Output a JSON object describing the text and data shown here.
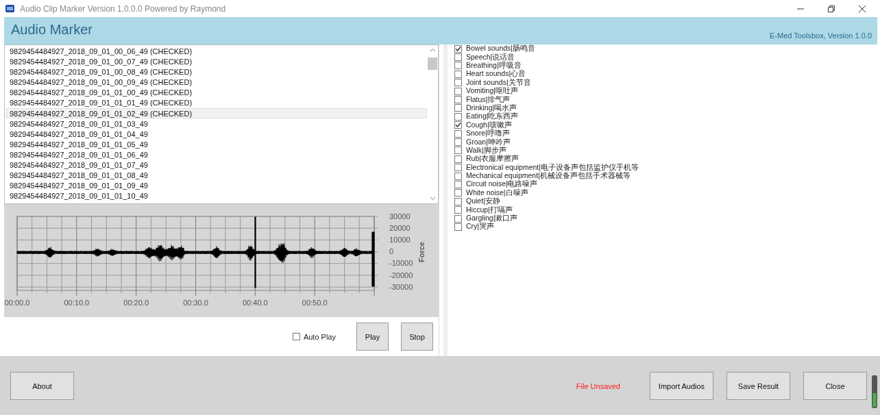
{
  "window": {
    "title": "Audio Clip Marker Version 1.0.0.0 Powered by Raymond"
  },
  "header": {
    "title": "Audio Marker",
    "version": "E-Med Toolsbox, Version 1.0.0"
  },
  "files": [
    {
      "name": "9829454484927_2018_09_01_00_06_49 (CHECKED)",
      "selected": false
    },
    {
      "name": "9829454484927_2018_09_01_00_07_49 (CHECKED)",
      "selected": false
    },
    {
      "name": "9829454484927_2018_09_01_00_08_49 (CHECKED)",
      "selected": false
    },
    {
      "name": "9829454484927_2018_09_01_00_09_49 (CHECKED)",
      "selected": false
    },
    {
      "name": "9829454484927_2018_09_01_01_00_49 (CHECKED)",
      "selected": false
    },
    {
      "name": "9829454484927_2018_09_01_01_01_49 (CHECKED)",
      "selected": false
    },
    {
      "name": "9829454484927_2018_09_01_01_02_49 (CHECKED)",
      "selected": true
    },
    {
      "name": "9829454484927_2018_09_01_01_03_49",
      "selected": false
    },
    {
      "name": "9829454484927_2018_09_01_01_04_49",
      "selected": false
    },
    {
      "name": "9829454484927_2018_09_01_01_05_49",
      "selected": false
    },
    {
      "name": "9829454484927_2018_09_01_01_06_49",
      "selected": false
    },
    {
      "name": "9829454484927_2018_09_01_01_07_49",
      "selected": false
    },
    {
      "name": "9829454484927_2018_09_01_01_08_49",
      "selected": false
    },
    {
      "name": "9829454484927_2018_09_01_01_09_49",
      "selected": false
    },
    {
      "name": "9829454484927_2018_09_01_01_10_49",
      "selected": false
    }
  ],
  "waveform": {
    "ylabel": "Force",
    "yticks": [
      "30000",
      "20000",
      "10000",
      "0",
      "-10000",
      "-20000",
      "-30000"
    ],
    "xticks": [
      "00:00.0",
      "00:10.0",
      "00:20.0",
      "00:30.0",
      "00:40.0",
      "00:50.0"
    ]
  },
  "auto_play": {
    "label": "Auto Play",
    "checked": false
  },
  "player_buttons": [
    "Play",
    "Stop"
  ],
  "categories": [
    {
      "label": "Bowel sounds|肠鸣音",
      "checked": true
    },
    {
      "label": "Speech|说话音",
      "checked": false
    },
    {
      "label": "Breathing|呼吸音",
      "checked": false
    },
    {
      "label": "Heart sounds|心音",
      "checked": false
    },
    {
      "label": "Joint sounds|关节音",
      "checked": false
    },
    {
      "label": "Vomiting|呕吐声",
      "checked": false
    },
    {
      "label": "Flatus|排气声",
      "checked": false
    },
    {
      "label": "Drinking|喝水声",
      "checked": false
    },
    {
      "label": "Eating|吃东西声",
      "checked": false
    },
    {
      "label": "Cough|咳嗽声",
      "checked": true
    },
    {
      "label": "Snore|呼噜声",
      "checked": false
    },
    {
      "label": "Groan|呻吟声",
      "checked": false
    },
    {
      "label": "Walk|脚步声",
      "checked": false
    },
    {
      "label": "Rub|衣服摩擦声",
      "checked": false
    },
    {
      "label": "Electronical equipment|电子设备声包括监护仪手机等",
      "checked": false
    },
    {
      "label": "Mechanical equipment|机械设备声包括手术器械等",
      "checked": false
    },
    {
      "label": "Circuit noise|电路噪声",
      "checked": false
    },
    {
      "label": "White noise|白噪声",
      "checked": false
    },
    {
      "label": "Quiet|安静",
      "checked": false
    },
    {
      "label": "Hiccup|打嗝声",
      "checked": false
    },
    {
      "label": "Gargling|漱口声",
      "checked": false
    },
    {
      "label": "Cry|哭声",
      "checked": false
    }
  ],
  "footer": {
    "about": "About",
    "status": "File Unsaved",
    "buttons": [
      "Import Audios",
      "Save Result",
      "Close"
    ]
  }
}
